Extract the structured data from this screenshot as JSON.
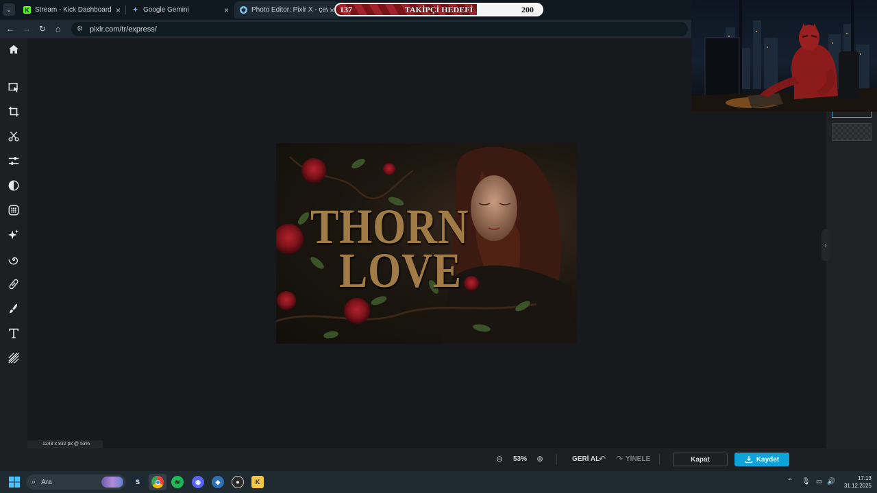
{
  "browser": {
    "tabs": [
      {
        "label": "Stream - Kick Dashboard",
        "icon": "kick-icon"
      },
      {
        "label": "Google Gemini",
        "icon": "gemini-icon"
      },
      {
        "label": "Photo Editor: Pixlr X - çevrimiçi",
        "icon": "pixlr-icon",
        "active": true
      }
    ],
    "url": "pixlr.com/tr/express/"
  },
  "follower_goal": {
    "title": "TAKİPÇİ HEDEFİ",
    "current": "137",
    "target": "200",
    "progress": 0.685
  },
  "editor": {
    "left_tools": [
      "home-icon",
      "arrange-icon",
      "crop-icon",
      "cutout-icon",
      "adjust-icon",
      "filter-icon",
      "effect-icon",
      "ai-sparkle-icon",
      "liquify-icon",
      "retouch-icon",
      "draw-icon",
      "text-icon",
      "pattern-icon"
    ],
    "artwork": {
      "line1": "THORN",
      "line2": "LOVE"
    },
    "size_info": "1248 x 832 px @ 53%",
    "zoom": "53%",
    "undo_label": "GERİ AL",
    "redo_label": "YİNELE",
    "close_label": "Kapat",
    "save_label": "Kaydet"
  },
  "taskbar": {
    "search_placeholder": "Ara",
    "time": "17:13",
    "date": "31.12.2025"
  },
  "colors": {
    "accent": "#0fa3d9",
    "goal_fill": "#8b1c21",
    "title_gold": "#a07b45"
  }
}
